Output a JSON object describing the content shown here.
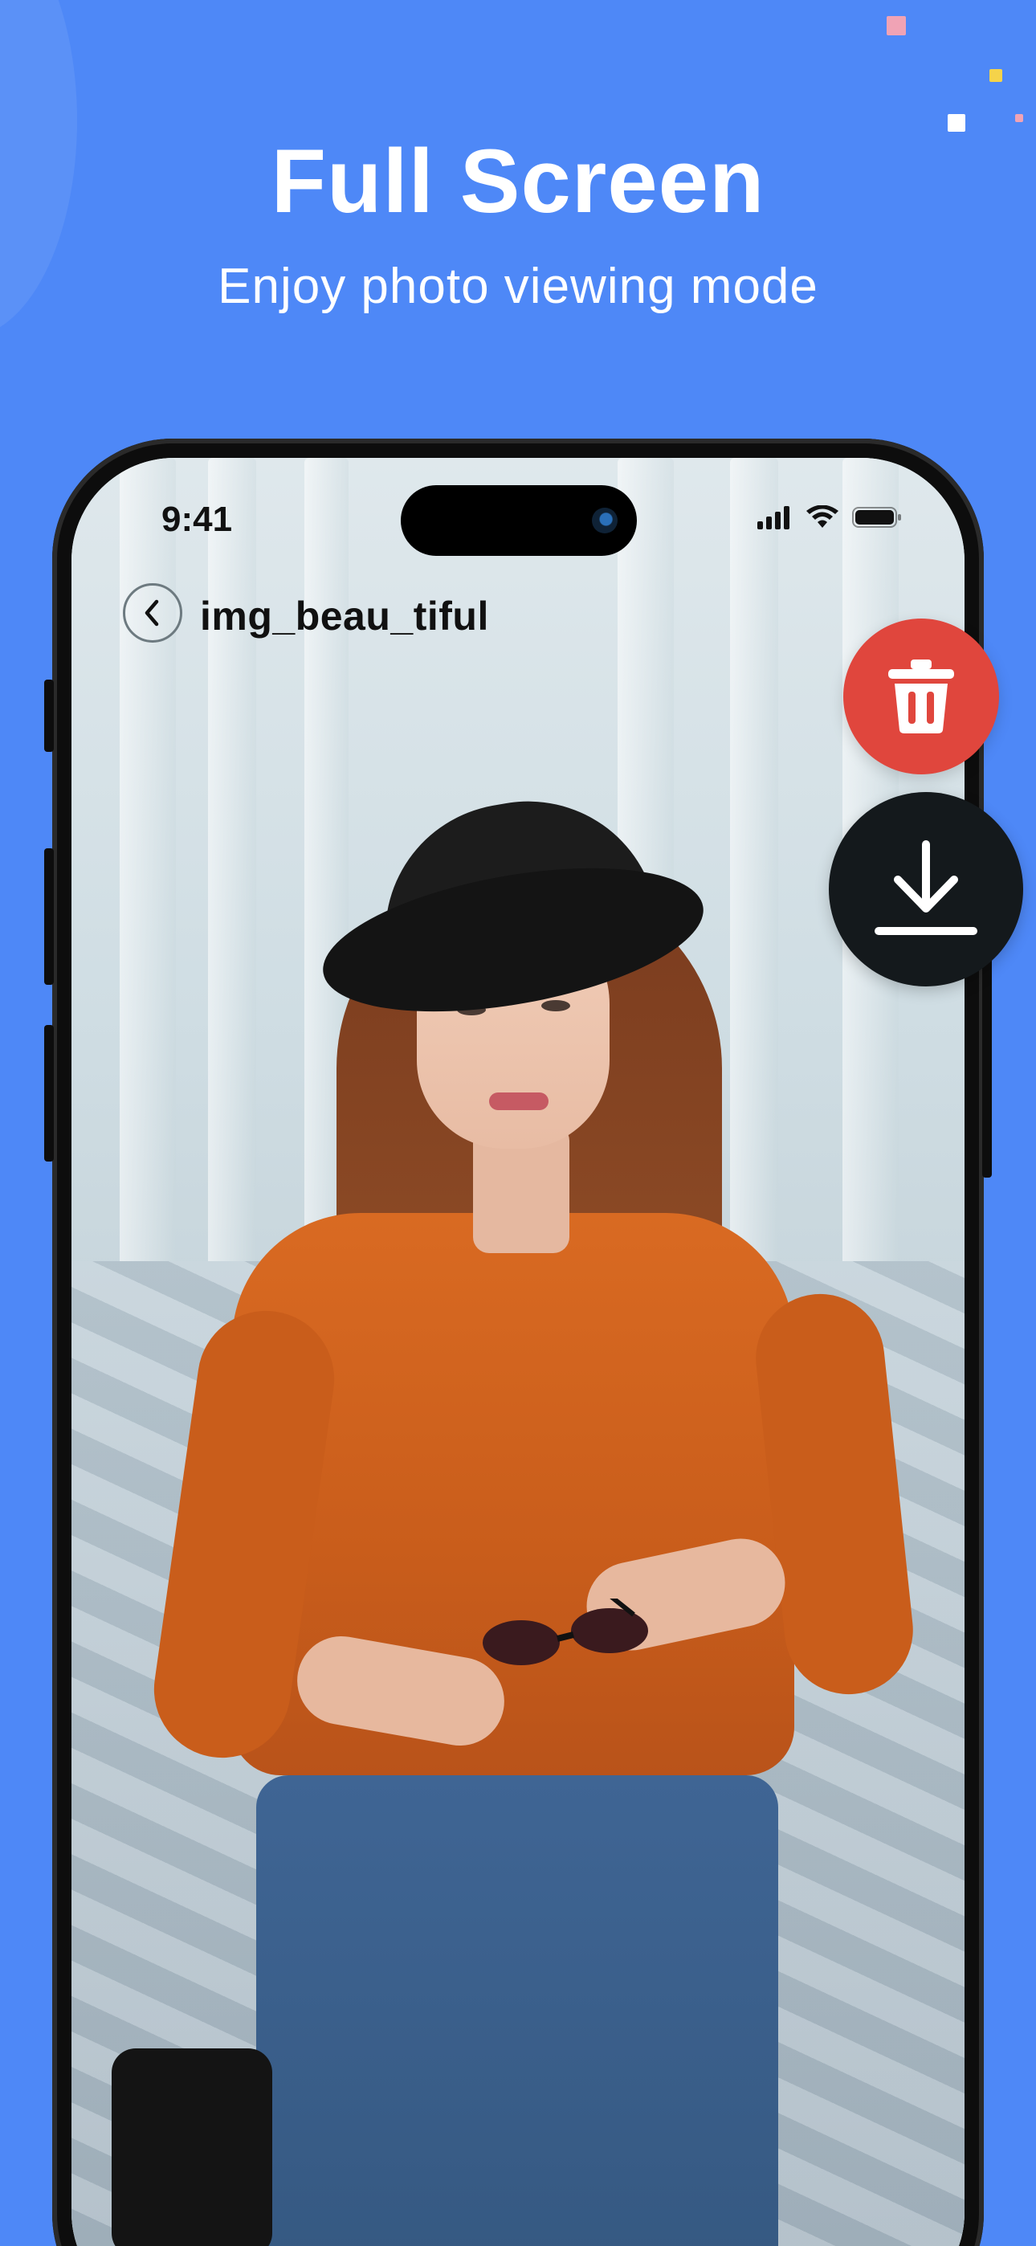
{
  "hero": {
    "title": "Full Screen",
    "subtitle": "Enjoy photo viewing mode"
  },
  "status_bar": {
    "time": "9:41",
    "icons": [
      "signal-icon",
      "wifi-icon",
      "battery-icon"
    ]
  },
  "viewer": {
    "file_name": "img_beau_tiful",
    "back_icon": "chevron-left-icon",
    "photo_subject": "woman-in-orange-top-and-black-hat"
  },
  "actions": {
    "delete_icon": "trash-icon",
    "download_icon": "download-icon"
  },
  "colors": {
    "background": "#4e88f7",
    "delete": "#e0463d",
    "download": "#14191c",
    "text_on_bg": "#ffffff"
  }
}
